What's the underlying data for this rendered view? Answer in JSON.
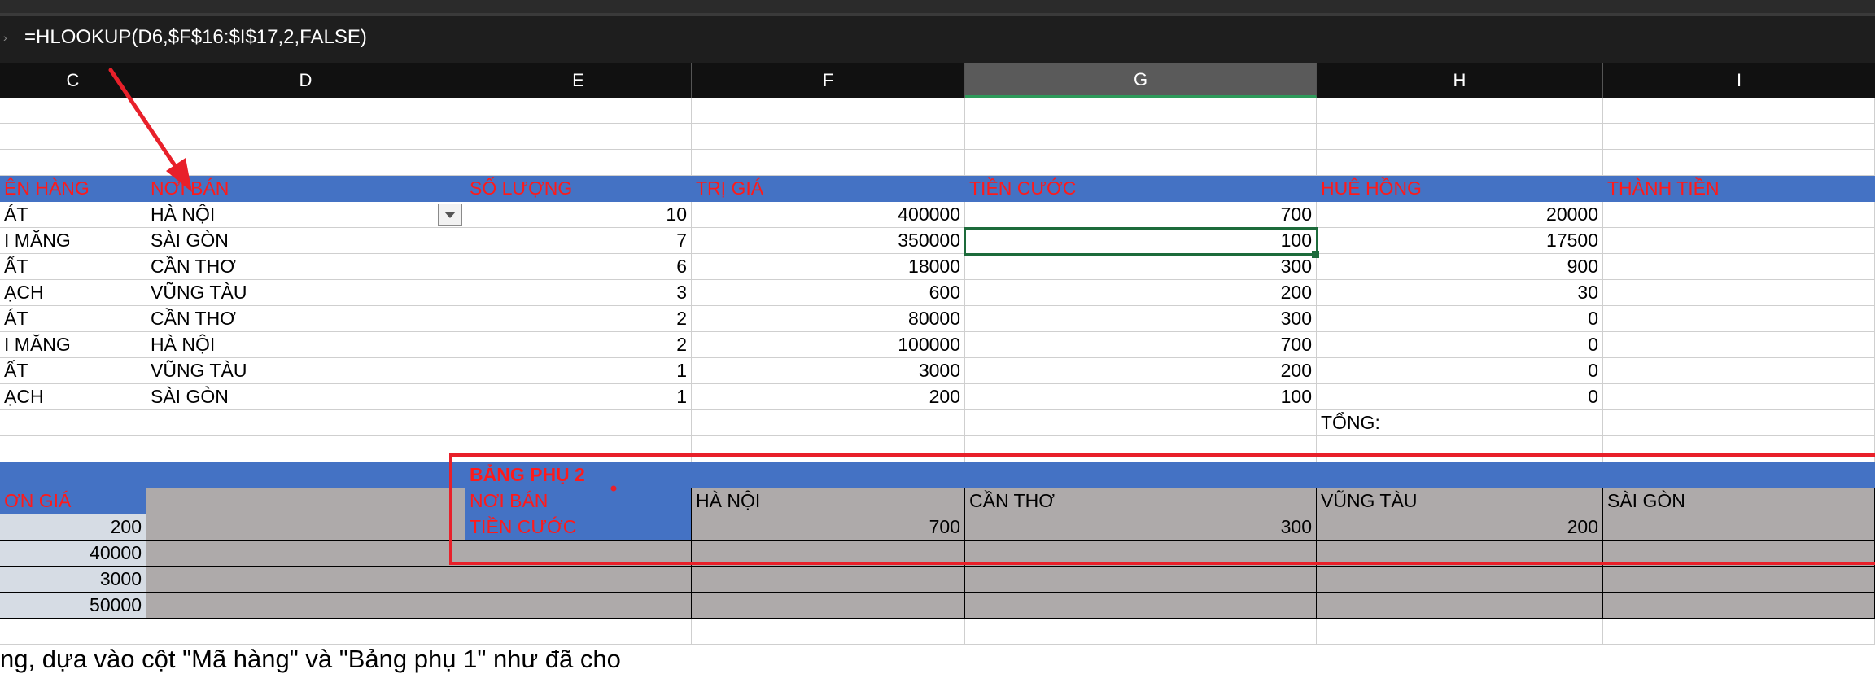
{
  "formula_bar": {
    "formula": "=HLOOKUP(D6,$F$16:$I$17,2,FALSE)"
  },
  "columns": [
    "C",
    "D",
    "E",
    "F",
    "G",
    "H",
    "I"
  ],
  "main_table": {
    "headers": [
      "ÊN HÀNG",
      "NƠI BÁN",
      "SỐ LƯỢNG",
      "TRỊ GIÁ",
      "TIỀN CƯỚC",
      "HUÊ HỒNG",
      "THÀNH TIỀN"
    ],
    "rows": [
      [
        "ÁT",
        "HÀ NỘI",
        "10",
        "400000",
        "700",
        "20000",
        ""
      ],
      [
        "I MĂNG",
        "SÀI GÒN",
        "7",
        "350000",
        "100",
        "17500",
        ""
      ],
      [
        "ẤT",
        "CẦN THƠ",
        "6",
        "18000",
        "300",
        "900",
        ""
      ],
      [
        "ẠCH",
        "VŨNG TÀU",
        "3",
        "600",
        "200",
        "30",
        ""
      ],
      [
        "ÁT",
        "CẦN THƠ",
        "2",
        "80000",
        "300",
        "0",
        ""
      ],
      [
        "I MĂNG",
        "HÀ NỘI",
        "2",
        "100000",
        "700",
        "0",
        ""
      ],
      [
        "ẤT",
        "VŨNG TÀU",
        "1",
        "3000",
        "200",
        "0",
        ""
      ],
      [
        "ẠCH",
        "SÀI GÒN",
        "1",
        "200",
        "100",
        "0",
        ""
      ]
    ],
    "total_label": "TỔNG:"
  },
  "aux_table_1": {
    "header": "ƠN GIÁ",
    "values": [
      "200",
      "40000",
      "3000",
      "50000"
    ]
  },
  "aux_table_2": {
    "title": "BẢNG PHỤ 2",
    "row1_label": "NƠI BÁN",
    "row2_label": "TIỀN CƯỚC",
    "cities": [
      "HÀ NỘI",
      "CẦN THƠ",
      "VŨNG TÀU",
      "SÀI GÒN"
    ],
    "fees": [
      "700",
      "300",
      "200",
      ""
    ]
  },
  "note": "ng, dựa vào cột \"Mã hàng\" và \"Bảng phụ 1\" như đã cho",
  "colors": {
    "header_blue": "#4472c4",
    "header_text_red": "#ff1a1a",
    "aux_grey": "#aeaaaa",
    "highlight_red": "#e8202a",
    "active_green": "#1d6b3b"
  }
}
